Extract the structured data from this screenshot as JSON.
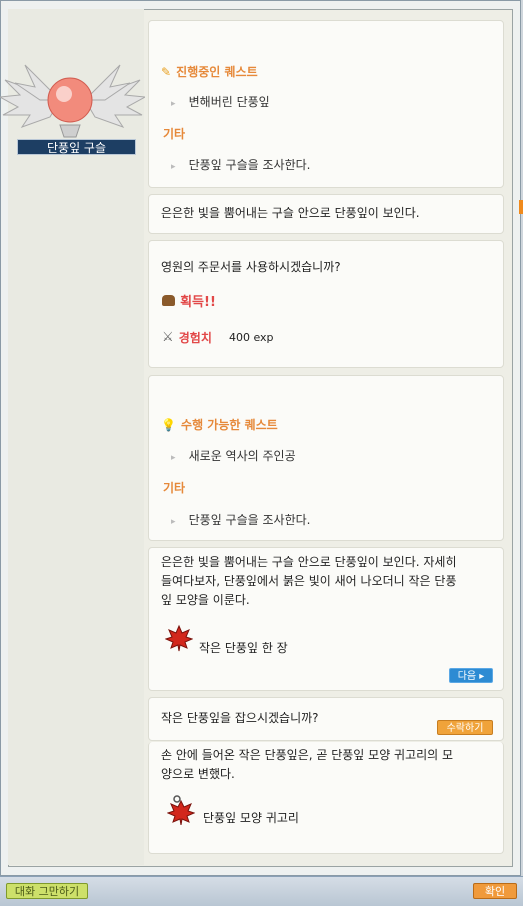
{
  "npc": {
    "name": "단풍잎 구슬"
  },
  "quest_in_progress": {
    "heading": "진행중인 퀘스트",
    "quest_name": "변해버린 단풍잎",
    "etc_label": "기타",
    "etc_item": "단풍잎 구슬을 조사한다."
  },
  "dialog1": {
    "text": "은은한 빛을 뿜어내는 구슬 안으로 단풍잎이 보인다."
  },
  "dialog2": {
    "question": "영원의 주문서를 사용하시겠습니까?",
    "reward_label": "획득!!",
    "exp_label": "경험치",
    "exp_value": "400 exp"
  },
  "quest_available": {
    "heading": "수행 가능한 퀘스트",
    "quest_name": "새로운 역사의 주인공",
    "etc_label": "기타",
    "etc_item": "단풍잎 구슬을 조사한다."
  },
  "dialog3": {
    "line1": "은은한 빛을 뿜어내는 구슬 안으로 단풍잎이 보인다. 자세히",
    "line2": "들여다보자, 단풍잎에서 붉은 빛이 새어 나오더니 작은 단풍",
    "line3": "잎 모양을 이룬다.",
    "item_name": "작은 단풍잎 한 장",
    "next_button": "다음"
  },
  "dialog4": {
    "question": "작은 단풍잎을 잡으시겠습니까?",
    "accept_button": "수락하기"
  },
  "dialog5": {
    "line1": "손 안에 들어온 작은 단풍잎은, 곧 단풍잎 모양 귀고리의 모",
    "line2": "양으로 변했다.",
    "item_name": "단풍잎 모양 귀고리"
  },
  "footer": {
    "end_chat": "대화 그만하기",
    "ok": "확인"
  },
  "colors": {
    "accent_orange": "#e6893a",
    "npc_tag_bg": "#1d3e63",
    "next_blue": "#2d8bd3"
  }
}
